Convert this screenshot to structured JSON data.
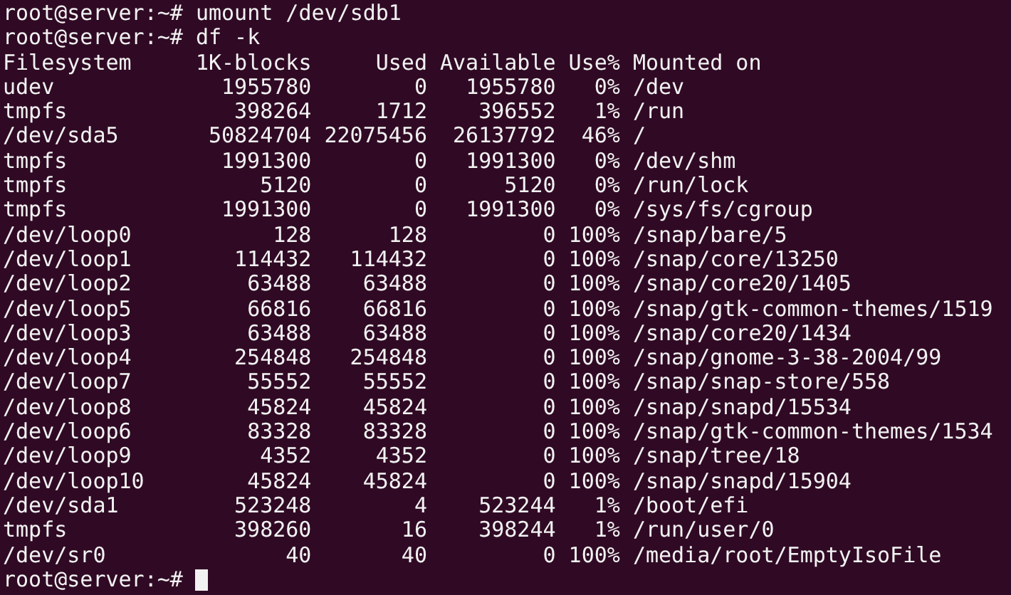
{
  "commands": [
    {
      "prompt": "root@server:~#",
      "command": "umount /dev/sdb1"
    },
    {
      "prompt": "root@server:~#",
      "command": "df -k"
    }
  ],
  "df_output": {
    "columns": [
      "Filesystem",
      "1K-blocks",
      "Used",
      "Available",
      "Use%",
      "Mounted on"
    ],
    "rows": [
      [
        "udev",
        "1955780",
        "0",
        "1955780",
        "0%",
        "/dev"
      ],
      [
        "tmpfs",
        "398264",
        "1712",
        "396552",
        "1%",
        "/run"
      ],
      [
        "/dev/sda5",
        "50824704",
        "22075456",
        "26137792",
        "46%",
        "/"
      ],
      [
        "tmpfs",
        "1991300",
        "0",
        "1991300",
        "0%",
        "/dev/shm"
      ],
      [
        "tmpfs",
        "5120",
        "0",
        "5120",
        "0%",
        "/run/lock"
      ],
      [
        "tmpfs",
        "1991300",
        "0",
        "1991300",
        "0%",
        "/sys/fs/cgroup"
      ],
      [
        "/dev/loop0",
        "128",
        "128",
        "0",
        "100%",
        "/snap/bare/5"
      ],
      [
        "/dev/loop1",
        "114432",
        "114432",
        "0",
        "100%",
        "/snap/core/13250"
      ],
      [
        "/dev/loop2",
        "63488",
        "63488",
        "0",
        "100%",
        "/snap/core20/1405"
      ],
      [
        "/dev/loop5",
        "66816",
        "66816",
        "0",
        "100%",
        "/snap/gtk-common-themes/1519"
      ],
      [
        "/dev/loop3",
        "63488",
        "63488",
        "0",
        "100%",
        "/snap/core20/1434"
      ],
      [
        "/dev/loop4",
        "254848",
        "254848",
        "0",
        "100%",
        "/snap/gnome-3-38-2004/99"
      ],
      [
        "/dev/loop7",
        "55552",
        "55552",
        "0",
        "100%",
        "/snap/snap-store/558"
      ],
      [
        "/dev/loop8",
        "45824",
        "45824",
        "0",
        "100%",
        "/snap/snapd/15534"
      ],
      [
        "/dev/loop6",
        "83328",
        "83328",
        "0",
        "100%",
        "/snap/gtk-common-themes/1534"
      ],
      [
        "/dev/loop9",
        "4352",
        "4352",
        "0",
        "100%",
        "/snap/tree/18"
      ],
      [
        "/dev/loop10",
        "45824",
        "45824",
        "0",
        "100%",
        "/snap/snapd/15904"
      ],
      [
        "/dev/sda1",
        "523248",
        "4",
        "523244",
        "1%",
        "/boot/efi"
      ],
      [
        "tmpfs",
        "398260",
        "16",
        "398244",
        "1%",
        "/run/user/0"
      ],
      [
        "/dev/sr0",
        "40",
        "40",
        "0",
        "100%",
        "/media/root/EmptyIsoFile"
      ]
    ]
  },
  "current_prompt": {
    "prompt": "root@server:~#",
    "cursor": true
  }
}
